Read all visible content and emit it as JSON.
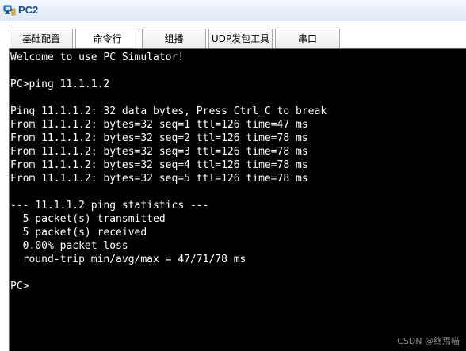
{
  "window": {
    "title": "PC2",
    "icon": "pc-simulator-icon"
  },
  "tabs": [
    {
      "label": "基础配置",
      "active": false
    },
    {
      "label": "命令行",
      "active": true
    },
    {
      "label": "组播",
      "active": false
    },
    {
      "label": "UDP发包工具",
      "active": false
    },
    {
      "label": "串口",
      "active": false
    }
  ],
  "terminal": {
    "lines": [
      "Welcome to use PC Simulator!",
      "",
      "PC>ping 11.1.1.2",
      "",
      "Ping 11.1.1.2: 32 data bytes, Press Ctrl_C to break",
      "From 11.1.1.2: bytes=32 seq=1 ttl=126 time=47 ms",
      "From 11.1.1.2: bytes=32 seq=2 ttl=126 time=78 ms",
      "From 11.1.1.2: bytes=32 seq=3 ttl=126 time=78 ms",
      "From 11.1.1.2: bytes=32 seq=4 ttl=126 time=78 ms",
      "From 11.1.1.2: bytes=32 seq=5 ttl=126 time=78 ms",
      "",
      "--- 11.1.1.2 ping statistics ---",
      "  5 packet(s) transmitted",
      "  5 packet(s) received",
      "  0.00% packet loss",
      "  round-trip min/avg/max = 47/71/78 ms",
      "",
      "PC>"
    ]
  },
  "watermark": "CSDN @终焉喵",
  "colors": {
    "terminal_bg": "#000000",
    "terminal_fg": "#ffffff",
    "title_text": "#1b4f8c"
  }
}
